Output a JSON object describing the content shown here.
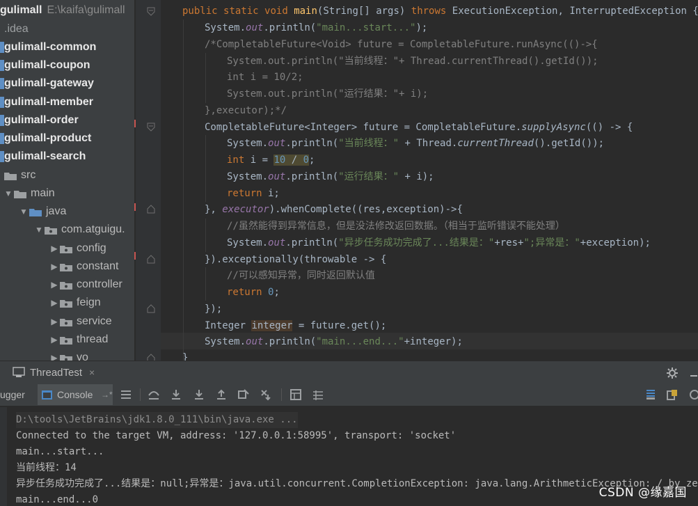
{
  "project_tree": {
    "root_name": "gulimall",
    "root_path": "E:\\kaifa\\gulimall",
    "items": [
      {
        "label": ".idea",
        "bold": false
      },
      {
        "label": "gulimall-common",
        "bold": true
      },
      {
        "label": "gulimall-coupon",
        "bold": true
      },
      {
        "label": "gulimall-gateway",
        "bold": true
      },
      {
        "label": "gulimall-member",
        "bold": true
      },
      {
        "label": "gulimall-order",
        "bold": true
      },
      {
        "label": "gulimall-product",
        "bold": true
      },
      {
        "label": "gulimall-search",
        "bold": true
      },
      {
        "label": "src",
        "bold": false
      },
      {
        "label": "main",
        "bold": false
      },
      {
        "label": "java",
        "bold": false
      },
      {
        "label": "com.atguigu.",
        "bold": false
      },
      {
        "label": "config",
        "bold": false
      },
      {
        "label": "constant",
        "bold": false
      },
      {
        "label": "controller",
        "bold": false
      },
      {
        "label": "feign",
        "bold": false
      },
      {
        "label": "service",
        "bold": false
      },
      {
        "label": "thread",
        "bold": false
      },
      {
        "label": "vo",
        "bold": false
      }
    ]
  },
  "editor": {
    "lines": [
      "public static void main(String[] args) throws ExecutionException, InterruptedException {",
      "System.out.println(\"main...start...\");",
      "/*CompletableFuture<Void> future = CompletableFuture.runAsync(()->{",
      "System.out.println(\"当前线程：\"+ Thread.currentThread().getId());",
      "int i = 10/2;",
      "System.out.println(\"运行结果：\"+ i);",
      "},executor);*/",
      "CompletableFuture<Integer> future = CompletableFuture.supplyAsync(() -> {",
      "System.out.println(\"当前线程：\" + Thread.currentThread().getId());",
      "int i = 10 / 0;",
      "System.out.println(\"运行结果：\" + i);",
      "return i;",
      "}, executor).whenComplete((res,exception)->{",
      "//虽然能得到异常信息，但是没法修改返回数据。（相当于监听错误不能处理）",
      "System.out.println(\"异步任务成功完成了...结果是：\"+res+\";异常是：\"+exception);",
      "}).exceptionally(throwable -> {",
      "//可以感知异常，同时返回默认值",
      "return 0;",
      "});",
      "Integer integer = future.get();",
      "System.out.println(\"main...end...\"+integer);",
      "}"
    ]
  },
  "run_tab": {
    "label": "ThreadTest",
    "close": "×"
  },
  "toolbar": {
    "debugger_label": "ugger",
    "console_label": "Console",
    "console_arrow": "→*"
  },
  "console": {
    "lines": [
      "D:\\tools\\JetBrains\\jdk1.8.0_111\\bin\\java.exe ...",
      "Connected to the target VM, address: '127.0.0.1:58995', transport: 'socket'",
      "main...start...",
      "当前线程：14",
      "异步任务成功完成了...结果是：null;异常是：java.util.concurrent.CompletionException: java.lang.ArithmeticException: / by zero",
      "main...end...0"
    ]
  },
  "watermark": "CSDN @缘嘉国",
  "colors": {
    "keyword": "#cc7832",
    "string": "#6a8759",
    "number": "#6897bb",
    "comment": "#808080",
    "field": "#9876aa",
    "method_decl": "#ffc66d",
    "text": "#a9b7c6"
  }
}
